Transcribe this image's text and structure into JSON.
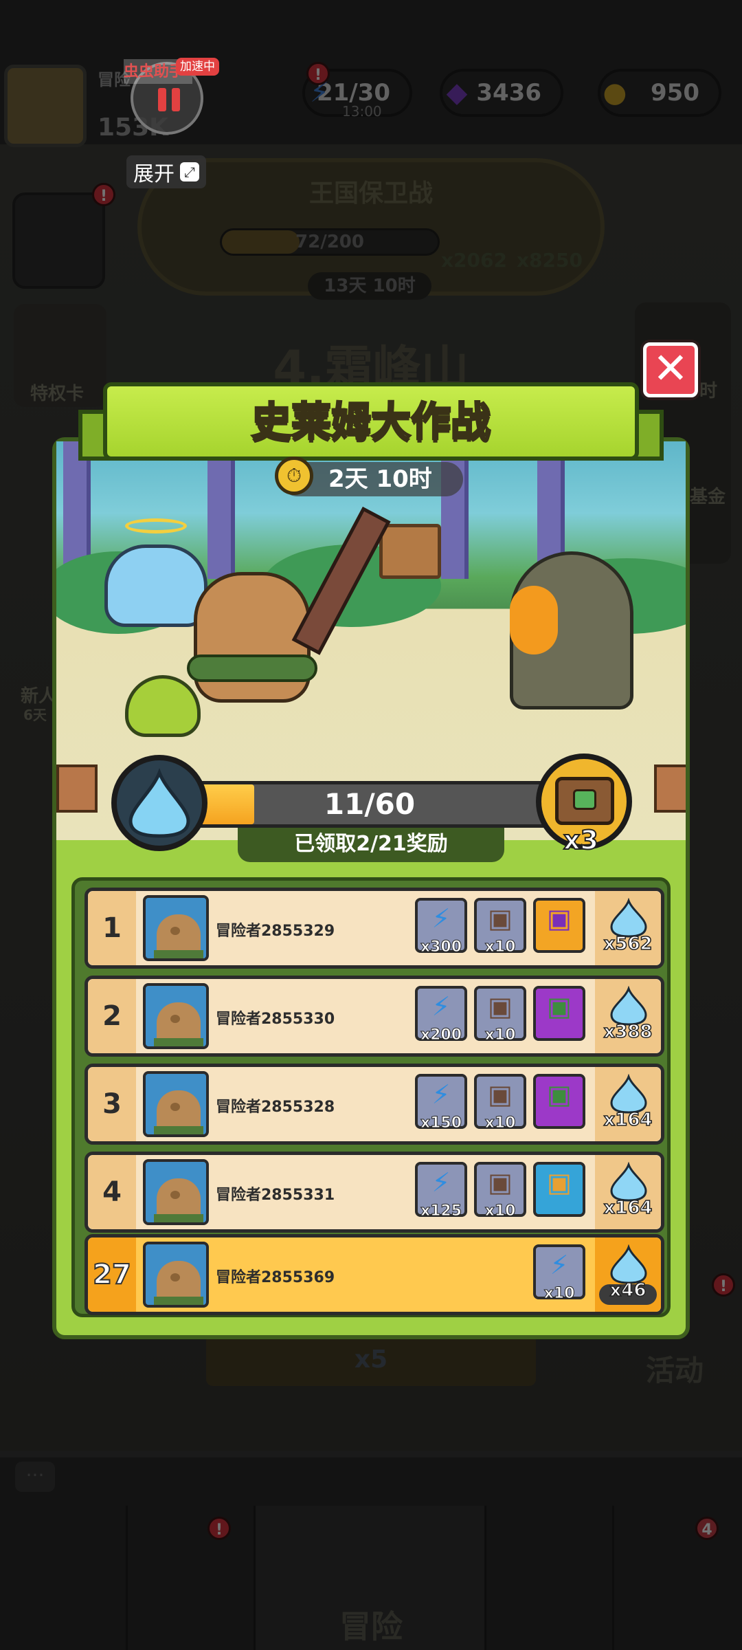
{
  "hud": {
    "player_name_short": "冒险",
    "player_subtitle": "冒险",
    "power": "153K",
    "energy": "21/30",
    "energy_time": "13:00",
    "gems": "3436",
    "coins": "950"
  },
  "kingdom": {
    "title": "王国保卫战",
    "progress": "72/200",
    "progress_fraction": 0.36,
    "time_left": "13天 10时",
    "reward_a": "x2062",
    "reward_b": "x8250"
  },
  "background": {
    "stage_title": "4.霜峰山",
    "privilege_card": "特权卡",
    "new_player": "新人",
    "new_player_days": "6天",
    "fund_label": "基金",
    "hour_label": "时",
    "bottom_energy_cost": "x5",
    "activity_label": "活动",
    "adventure_label": "冒险",
    "chest_badge_count": "4"
  },
  "overlay_tool": {
    "name": "虫虫助手",
    "tag": "加速中",
    "expand_label": "展开"
  },
  "popup": {
    "title": "史莱姆大作战",
    "timer": "2天 10时",
    "progress_text": "11/60",
    "progress_fraction": 0.183,
    "claimed_text": "已领取2/21奖励",
    "chest_multiplier": "x3",
    "close_icon": "close-icon"
  },
  "leaderboard": [
    {
      "rank": "1",
      "name": "冒险者2855329",
      "rewards": [
        {
          "type": "energy",
          "qty": "x300"
        },
        {
          "type": "chest-grey",
          "qty": "x10"
        },
        {
          "type": "chest-orange",
          "qty": ""
        }
      ],
      "score": "x562"
    },
    {
      "rank": "2",
      "name": "冒险者2855330",
      "rewards": [
        {
          "type": "energy",
          "qty": "x200"
        },
        {
          "type": "chest-grey",
          "qty": "x10"
        },
        {
          "type": "chest-purple",
          "qty": ""
        }
      ],
      "score": "x388"
    },
    {
      "rank": "3",
      "name": "冒险者2855328",
      "rewards": [
        {
          "type": "energy",
          "qty": "x150"
        },
        {
          "type": "chest-grey",
          "qty": "x10"
        },
        {
          "type": "chest-purple",
          "qty": ""
        }
      ],
      "score": "x164"
    },
    {
      "rank": "4",
      "name": "冒险者2855331",
      "rewards": [
        {
          "type": "energy",
          "qty": "x125"
        },
        {
          "type": "chest-grey",
          "qty": "x10"
        },
        {
          "type": "chest-blue",
          "qty": ""
        }
      ],
      "score": "x164"
    },
    {
      "rank": "27",
      "name": "冒险者2855369",
      "rewards": [
        {
          "type": "energy",
          "qty": "x10"
        }
      ],
      "score": "x46",
      "is_me": true
    }
  ],
  "colors": {
    "panel_green": "#9fd044",
    "progress_orange": "#f5a320",
    "close_red": "#e94553",
    "my_row": "#ffc94f"
  }
}
